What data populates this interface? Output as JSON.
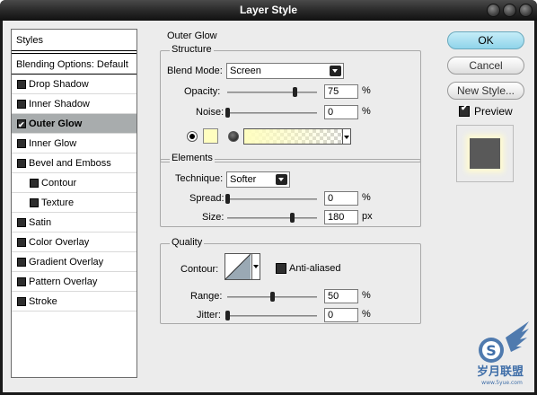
{
  "window": {
    "title": "Layer Style"
  },
  "styles_panel": {
    "header": "Styles",
    "blending_options": "Blending Options: Default",
    "items": [
      {
        "label": "Drop Shadow",
        "checked": false,
        "active": false,
        "sub": false
      },
      {
        "label": "Inner Shadow",
        "checked": false,
        "active": false,
        "sub": false
      },
      {
        "label": "Outer Glow",
        "checked": true,
        "active": true,
        "sub": false
      },
      {
        "label": "Inner Glow",
        "checked": false,
        "active": false,
        "sub": false
      },
      {
        "label": "Bevel and Emboss",
        "checked": false,
        "active": false,
        "sub": false
      },
      {
        "label": "Contour",
        "checked": false,
        "active": false,
        "sub": true
      },
      {
        "label": "Texture",
        "checked": false,
        "active": false,
        "sub": true
      },
      {
        "label": "Satin",
        "checked": false,
        "active": false,
        "sub": false
      },
      {
        "label": "Color Overlay",
        "checked": false,
        "active": false,
        "sub": false
      },
      {
        "label": "Gradient Overlay",
        "checked": false,
        "active": false,
        "sub": false
      },
      {
        "label": "Pattern Overlay",
        "checked": false,
        "active": false,
        "sub": false
      },
      {
        "label": "Stroke",
        "checked": false,
        "active": false,
        "sub": false
      }
    ]
  },
  "outer_glow": {
    "section_title": "Outer Glow",
    "structure": {
      "title": "Structure",
      "blend_mode_label": "Blend Mode:",
      "blend_mode_value": "Screen",
      "opacity_label": "Opacity:",
      "opacity_value": "75",
      "opacity_fraction": 0.75,
      "noise_label": "Noise:",
      "noise_value": "0",
      "noise_fraction": 0.0,
      "unit": "%",
      "glow_color": "#fffec0"
    },
    "elements": {
      "title": "Elements",
      "technique_label": "Technique:",
      "technique_value": "Softer",
      "spread_label": "Spread:",
      "spread_value": "0",
      "spread_fraction": 0.0,
      "spread_unit": "%",
      "size_label": "Size:",
      "size_value": "180",
      "size_fraction": 0.72,
      "size_unit": "px"
    },
    "quality": {
      "title": "Quality",
      "contour_label": "Contour:",
      "anti_aliased_label": "Anti-aliased",
      "anti_aliased_checked": false,
      "range_label": "Range:",
      "range_value": "50",
      "range_fraction": 0.5,
      "range_unit": "%",
      "jitter_label": "Jitter:",
      "jitter_value": "0",
      "jitter_fraction": 0.0,
      "jitter_unit": "%"
    }
  },
  "buttons": {
    "ok": "OK",
    "cancel": "Cancel",
    "new_style": "New Style...",
    "preview_label": "Preview",
    "preview_checked": true
  }
}
